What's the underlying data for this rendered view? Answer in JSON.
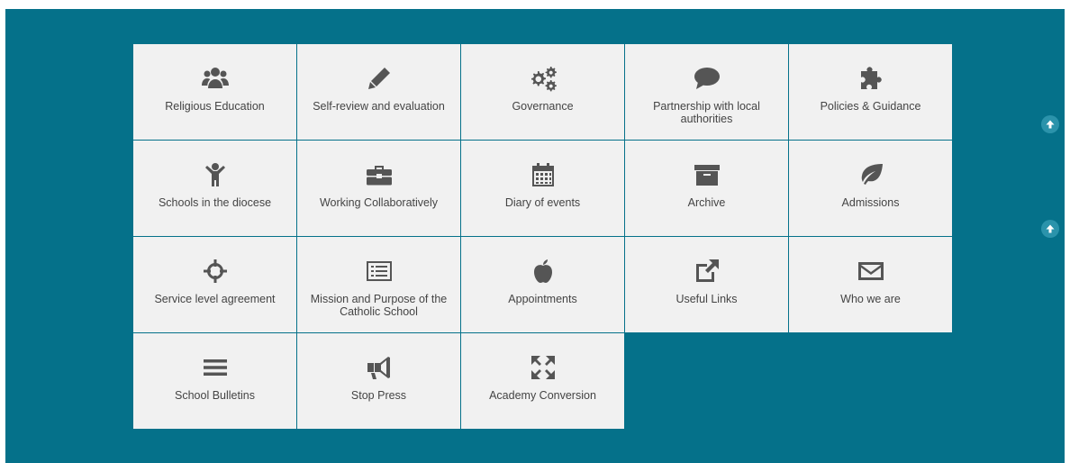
{
  "colors": {
    "panel": "#05718a",
    "tile": "#f1f1f1",
    "icon": "#555555",
    "text": "#444444",
    "button": "#2b93ab"
  },
  "tiles": [
    {
      "label": "Religious Education",
      "icon": "users-icon"
    },
    {
      "label": "Self-review and evaluation",
      "icon": "pencil-icon"
    },
    {
      "label": "Governance",
      "icon": "gears-icon"
    },
    {
      "label": "Partnership with local authorities",
      "icon": "speech-bubble-icon"
    },
    {
      "label": "Policies & Guidance",
      "icon": "puzzle-icon"
    },
    {
      "label": "Schools in the diocese",
      "icon": "child-icon"
    },
    {
      "label": "Working Collaboratively",
      "icon": "briefcase-icon"
    },
    {
      "label": "Diary of events",
      "icon": "calendar-icon"
    },
    {
      "label": "Archive",
      "icon": "archive-icon"
    },
    {
      "label": "Admissions",
      "icon": "leaf-icon"
    },
    {
      "label": "Service level agreement",
      "icon": "crosshairs-icon"
    },
    {
      "label": "Mission and Purpose of the Catholic School",
      "icon": "list-alt-icon"
    },
    {
      "label": "Appointments",
      "icon": "apple-icon"
    },
    {
      "label": "Useful Links",
      "icon": "external-link-icon"
    },
    {
      "label": "Who we are",
      "icon": "envelope-icon"
    },
    {
      "label": "School Bulletins",
      "icon": "bars-icon"
    },
    {
      "label": "Stop Press",
      "icon": "bullhorn-icon"
    },
    {
      "label": "Academy Conversion",
      "icon": "expand-icon"
    }
  ],
  "scroll_buttons": [
    {
      "icon": "arrow-up-icon"
    },
    {
      "icon": "arrow-up-icon"
    }
  ]
}
